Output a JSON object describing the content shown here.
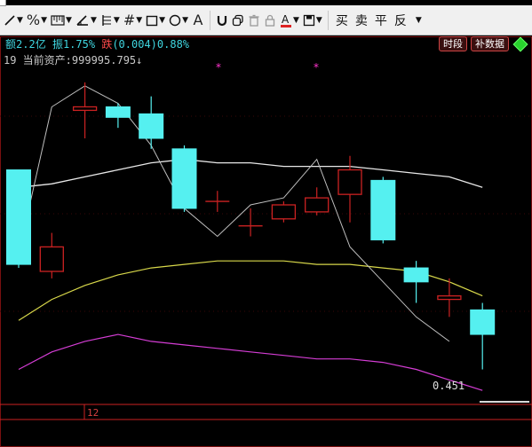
{
  "toolbar": {
    "trade_buttons": [
      "买",
      "卖",
      "平",
      "反"
    ]
  },
  "info": {
    "amount_label": "额",
    "amount_value": "2.2亿",
    "amplitude_label": "振",
    "amplitude_value": "1.75%",
    "change_label": "跌",
    "change_value": "(0.004)0.88%"
  },
  "asset": {
    "text": "19 当前资产:999995.795",
    "arrow": "↓"
  },
  "badges": {
    "period": "时段",
    "supplement": "补数据"
  },
  "chart_data": {
    "type": "candlestick",
    "candles": [
      {
        "open": 0.512,
        "close": 0.485,
        "high": 0.511,
        "low": 0.484
      },
      {
        "open": 0.483,
        "close": 0.49,
        "high": 0.494,
        "low": 0.481
      },
      {
        "open": 0.529,
        "close": 0.53,
        "high": 0.537,
        "low": 0.521
      },
      {
        "open": 0.53,
        "close": 0.527,
        "high": 0.531,
        "low": 0.524
      },
      {
        "open": 0.528,
        "close": 0.521,
        "high": 0.533,
        "low": 0.518
      },
      {
        "open": 0.518,
        "close": 0.501,
        "high": 0.519,
        "low": 0.5
      },
      {
        "open": 0.503,
        "close": 0.503,
        "high": 0.506,
        "low": 0.5
      },
      {
        "open": 0.496,
        "close": 0.496,
        "high": 0.501,
        "low": 0.493
      },
      {
        "open": 0.498,
        "close": 0.502,
        "high": 0.503,
        "low": 0.497
      },
      {
        "open": 0.5,
        "close": 0.504,
        "high": 0.507,
        "low": 0.499
      },
      {
        "open": 0.505,
        "close": 0.512,
        "high": 0.516,
        "low": 0.497
      },
      {
        "open": 0.509,
        "close": 0.492,
        "high": 0.51,
        "low": 0.491
      },
      {
        "open": 0.484,
        "close": 0.48,
        "high": 0.486,
        "low": 0.474
      },
      {
        "open": 0.475,
        "close": 0.476,
        "high": 0.481,
        "low": 0.47
      },
      {
        "open": 0.472,
        "close": 0.465,
        "high": 0.474,
        "low": 0.455
      }
    ],
    "ma_upper": [
      0.469,
      0.475,
      0.479,
      0.482,
      0.484,
      0.485,
      0.486,
      0.486,
      0.486,
      0.485,
      0.485,
      0.484,
      0.483,
      0.48,
      0.476
    ],
    "ma_mid": [
      0.507,
      0.508,
      0.51,
      0.512,
      0.514,
      0.515,
      0.514,
      0.514,
      0.513,
      0.513,
      0.513,
      0.512,
      0.511,
      0.51,
      0.507
    ],
    "ma_lower": [
      0.455,
      0.46,
      0.463,
      0.465,
      0.463,
      0.462,
      0.461,
      0.46,
      0.459,
      0.458,
      0.458,
      0.457,
      0.455,
      0.452,
      0.449
    ],
    "zigzag": [
      0.488,
      0.53,
      0.536,
      0.531,
      0.519,
      0.501,
      0.493,
      0.502,
      0.504,
      0.515,
      0.49,
      0.48,
      0.47,
      0.463
    ],
    "min_label": "0.451",
    "date_label": "12"
  },
  "colors": {
    "up": "#cc2222",
    "down": "#55f0f0",
    "ma_mid": "#e8e8e8",
    "ma_upper": "#d8d84a",
    "ma_lower": "#d43dd4",
    "zigzag": "#bfbfbf",
    "marker": "#ff33cc"
  }
}
